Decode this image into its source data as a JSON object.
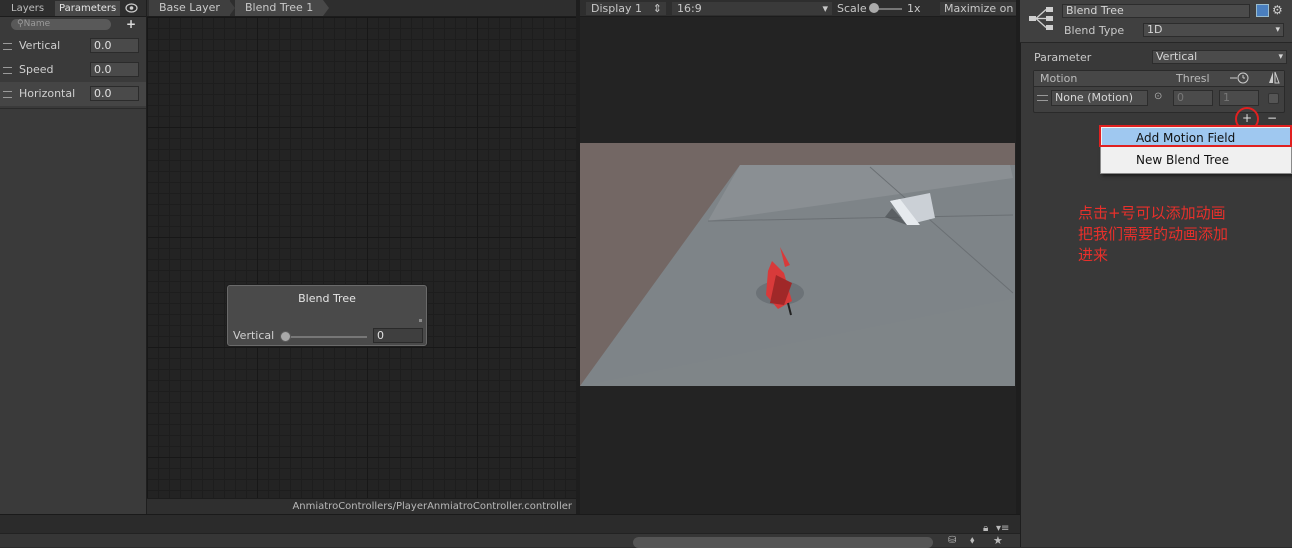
{
  "left_panel": {
    "tabs": [
      "Layers",
      "Parameters"
    ],
    "search_placeholder": "Name",
    "add_symbol": "+",
    "parameters": [
      {
        "name": "Vertical",
        "value": "0.0"
      },
      {
        "name": "Speed",
        "value": "0.0"
      },
      {
        "name": "Horizontal",
        "value": "0.0"
      }
    ]
  },
  "graph": {
    "breadcrumbs": [
      "Base Layer",
      "Blend Tree 1"
    ],
    "node": {
      "title": "Blend Tree",
      "param_label": "Vertical",
      "param_value": "0",
      "slider_fraction": 0
    },
    "status_path": "AnmiatroControllers/PlayerAnmiatroController.controller"
  },
  "game_view": {
    "display": "Display 1",
    "aspect": "16:9",
    "scale_label": "Scale",
    "scale_value": "1x",
    "maximize": "Maximize on P"
  },
  "inspector": {
    "name_value": "Blend Tree",
    "blend_type_label": "Blend Type",
    "blend_type_value": "1D",
    "parameter_label": "Parameter",
    "parameter_value": "Vertical",
    "motion_header": "Motion",
    "threshold_header": "Thresl",
    "motion_row": {
      "motion": "None (Motion)",
      "threshold": "0",
      "speed": "1"
    },
    "add_symbol": "+",
    "remove_symbol": "−"
  },
  "context_menu": {
    "items": [
      "Add Motion Field",
      "New Blend Tree"
    ],
    "highlighted": "Add Motion Field"
  },
  "annotation": {
    "lines": [
      "点击+号可以添加动画",
      "把我们需要的动画添加",
      "进来"
    ],
    "color": "#e8302b"
  },
  "colors": {
    "highlight": "#9fc8f0",
    "annotation_red": "#e02020"
  }
}
